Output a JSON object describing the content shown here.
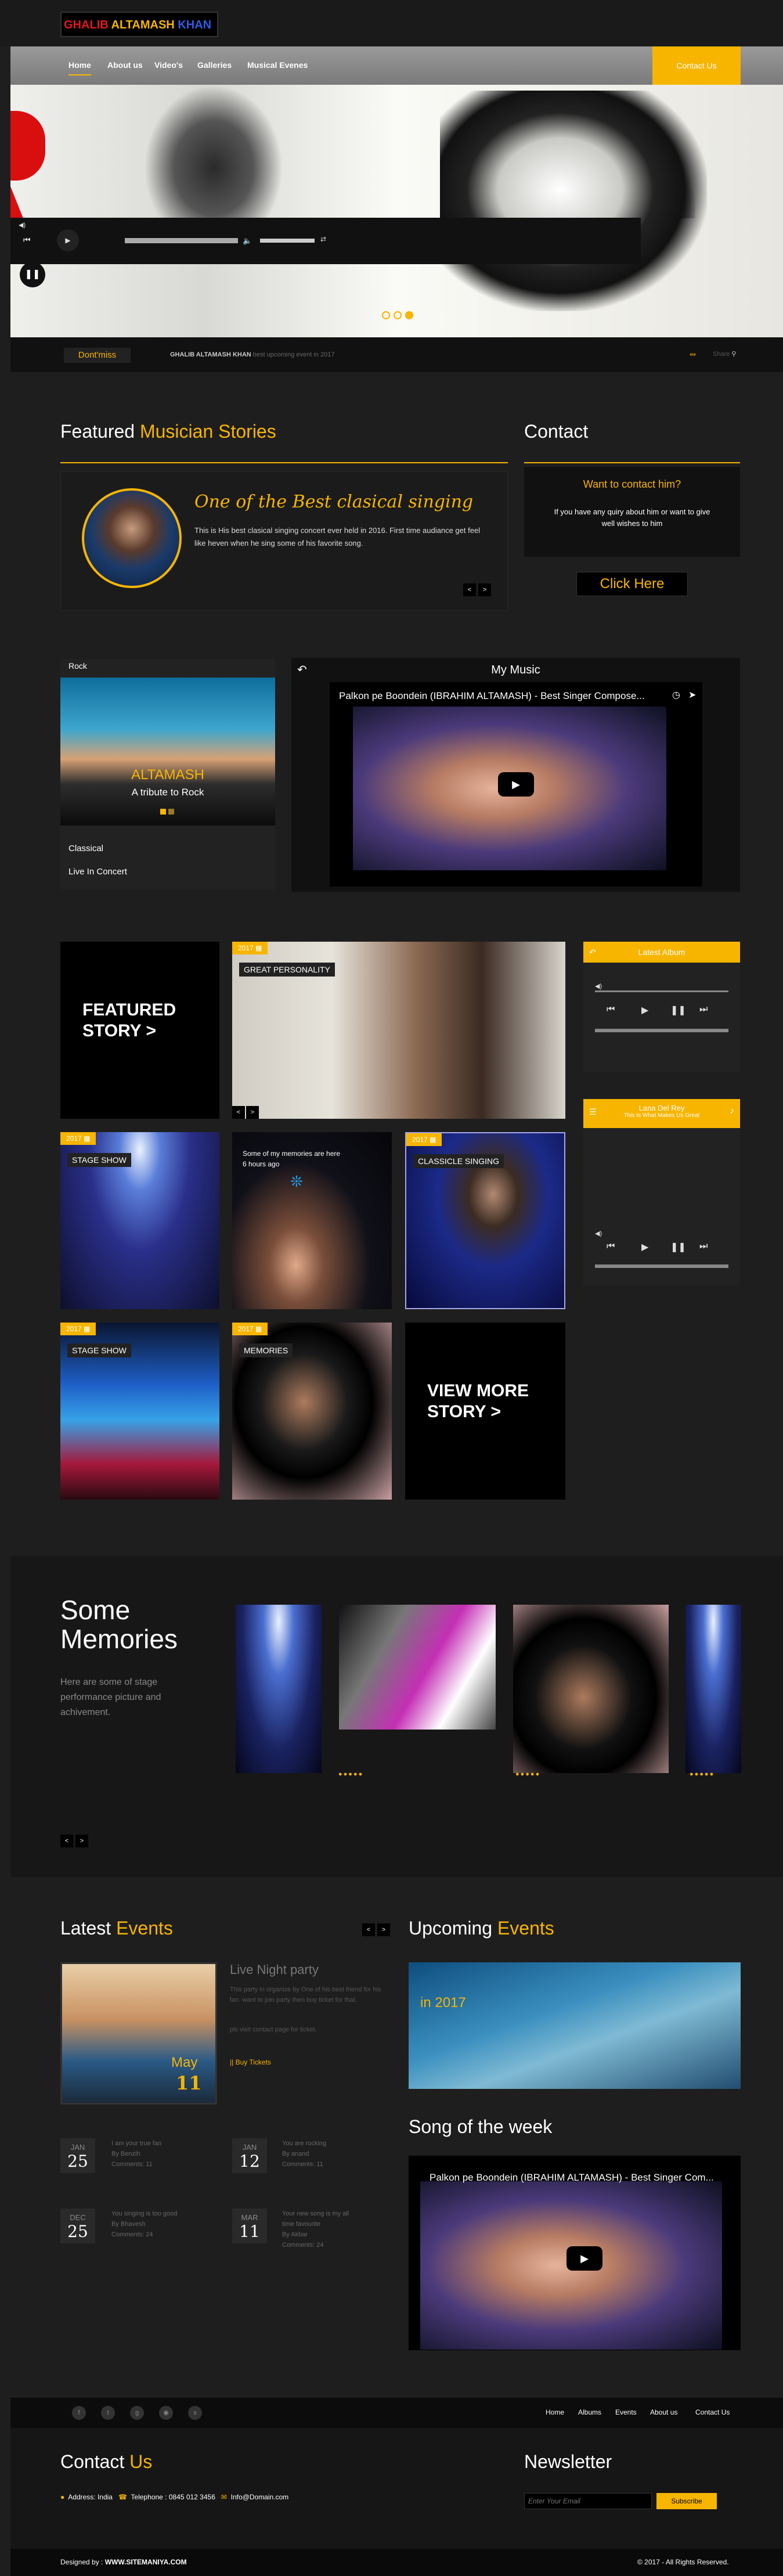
{
  "logo": {
    "part1": "GHALIB",
    "part2": "ALTAMASH",
    "part3": "KHAN"
  },
  "nav": {
    "items": [
      "Home",
      "About us",
      "Video's",
      "Galleries",
      "Musical Evenes"
    ],
    "contact": "Contact Us"
  },
  "hero": {
    "slide_count": 3,
    "active_slide": 2
  },
  "dont_miss": {
    "label": "Dont'miss",
    "name": "GHALIB ALTAMASH KHAN",
    "text": "best upcoming event in 2017",
    "share_label": "Share"
  },
  "featured": {
    "title_a": "Featured",
    "title_b": "Musician Stories",
    "story_title": "One of the Best clasical singing",
    "story_body": "This is His best clasical singing concert ever held in 2016. First time audiance get feel like heven when he sing some of his favorite song."
  },
  "contact_card": {
    "title": "Contact",
    "question": "Want to contact him?",
    "desc": "If you have any quiry about him or want to give well wishes to him",
    "button": "Click Here"
  },
  "rock": {
    "label": "Rock",
    "name": "ALTAMASH",
    "sub": "A tribute to Rock",
    "cat1": "Classical",
    "cat2": "Live In Concert"
  },
  "my_music": {
    "title": "My Music",
    "video_title": "Palkon pe Boondein (IBRAHIM ALTAMASH) - Best Singer Compose..."
  },
  "grid": {
    "featured_story": [
      "FEATURED",
      "STORY >"
    ],
    "great": {
      "year": "2017",
      "label": "GREAT PERSONALITY"
    },
    "stage1": {
      "year": "2017",
      "label": "STAGE SHOW"
    },
    "tweet": {
      "text": "Some of my memories are here",
      "time": "6 hours ago"
    },
    "classicle": {
      "year": "2017",
      "label": "CLASSICLE SINGING"
    },
    "stage2": {
      "year": "2017",
      "label": "STAGE SHOW"
    },
    "memories": {
      "year": "2017",
      "label": "MEMORIES"
    },
    "view_more": [
      "VIEW MORE",
      "STORY >"
    ]
  },
  "latest_album": {
    "title": "Latest Album"
  },
  "lana": {
    "title": "Lana Del Rey",
    "sub": "This Is What Makes Us Great"
  },
  "memories": {
    "title": "Some Memories",
    "desc": "Here are some of stage performance picture and achivement."
  },
  "latest_events": {
    "title_a": "Latest",
    "title_b": "Events",
    "event_title": "Live Night party",
    "event_body": "This party in organize by One of his best friend for his fan. want to join party then buy ticket for that.",
    "event_body2": "pls visit contact page for ticket.",
    "buy": "|| Buy Tickets",
    "month": "May",
    "day": "11",
    "items": [
      {
        "mon": "JAN",
        "day": "25",
        "title": "I am your true fan",
        "by": "By Benzih",
        "comments": "Comments: 11"
      },
      {
        "mon": "JAN",
        "day": "12",
        "title": "You are rocking",
        "by": "By anand",
        "comments": "Comments: 11"
      },
      {
        "mon": "DEC",
        "day": "25",
        "title": "You singing is too good",
        "by": "By Bhavesh",
        "comments": "Comments: 24"
      },
      {
        "mon": "MAR",
        "day": "11",
        "title": "Your new song is my all time favourite",
        "by": "By Akbar",
        "comments": "Comments: 24"
      }
    ]
  },
  "upcoming": {
    "title_a": "Upcoming",
    "title_b": "Events",
    "banner": "in 2017"
  },
  "song_week": {
    "title": "Song of the week",
    "video_title": "Palkon pe Boondein (IBRAHIM ALTAMASH) - Best Singer Com..."
  },
  "footer_nav": [
    "Home",
    "Albums",
    "Events",
    "About us",
    "Contact Us"
  ],
  "footer_contact": {
    "title_a": "Contact",
    "title_b": "Us",
    "address": "Address: India",
    "phone": "Telephone : 0845 012 3456",
    "email": "Info@Domain.com"
  },
  "newsletter": {
    "title": "Newsletter",
    "placeholder": "Enter Your Email",
    "button": "Subscribe"
  },
  "bottom": {
    "designed_by": "Designed by :",
    "site": "WWW.SITEMANIYA.COM",
    "copy": "© 2017 - All Rights Reserved."
  }
}
